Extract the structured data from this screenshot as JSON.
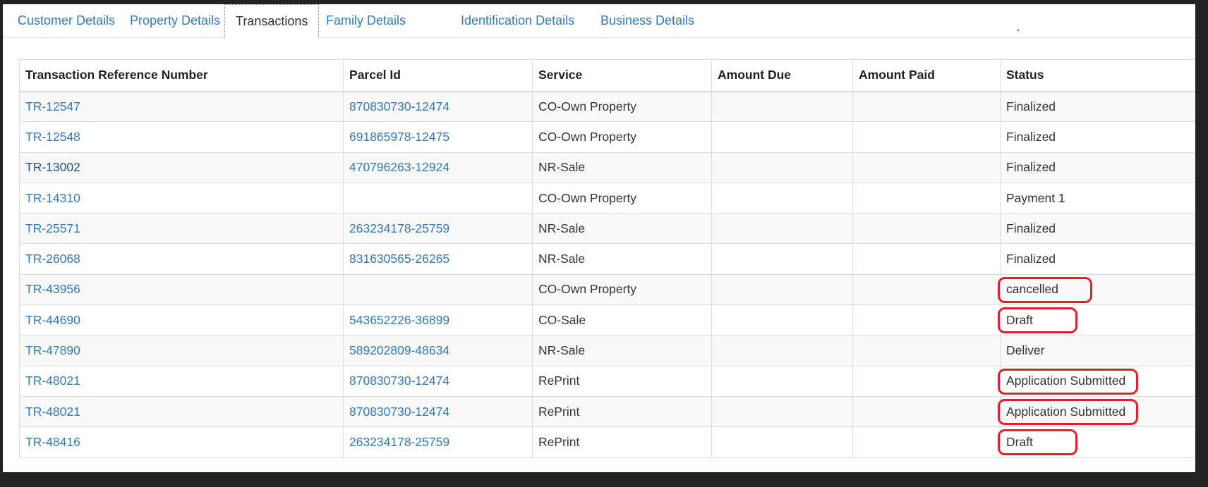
{
  "tabs": [
    {
      "label": "Customer Details",
      "active": false
    },
    {
      "label": "Property Details",
      "active": false
    },
    {
      "label": "Transactions",
      "active": true
    },
    {
      "label": "Family Details",
      "active": false
    },
    {
      "label": "Identification Details",
      "active": false
    },
    {
      "label": "Business Details",
      "active": false
    }
  ],
  "table": {
    "headers": [
      "Transaction Reference Number",
      "Parcel Id",
      "Service",
      "Amount Due",
      "Amount Paid",
      "Status"
    ],
    "rows": [
      {
        "ref": "TR-12547",
        "parcel": "870830730-12474",
        "service": "CO-Own Property",
        "amount_due": "",
        "amount_paid": "",
        "status": "Finalized",
        "highlighted": false
      },
      {
        "ref": "TR-12548",
        "parcel": "691865978-12475",
        "service": "CO-Own Property",
        "amount_due": "",
        "amount_paid": "",
        "status": "Finalized",
        "highlighted": false
      },
      {
        "ref": "TR-13002",
        "parcel": "470796263-12924",
        "service": "NR-Sale",
        "amount_due": "",
        "amount_paid": "",
        "status": "Finalized",
        "highlighted": false
      },
      {
        "ref": "TR-14310",
        "parcel": "",
        "service": "CO-Own Property",
        "amount_due": "",
        "amount_paid": "",
        "status": "Payment 1",
        "highlighted": false
      },
      {
        "ref": "TR-25571",
        "parcel": "263234178-25759",
        "service": "NR-Sale",
        "amount_due": "",
        "amount_paid": "",
        "status": "Finalized",
        "highlighted": false
      },
      {
        "ref": "TR-26068",
        "parcel": "831630565-26265",
        "service": "NR-Sale",
        "amount_due": "",
        "amount_paid": "",
        "status": "Finalized",
        "highlighted": false
      },
      {
        "ref": "TR-43956",
        "parcel": "",
        "service": "CO-Own Property",
        "amount_due": "",
        "amount_paid": "",
        "status": "cancelled",
        "highlighted": true
      },
      {
        "ref": "TR-44690",
        "parcel": "543652226-36899",
        "service": "CO-Sale",
        "amount_due": "",
        "amount_paid": "",
        "status": "Draft",
        "highlighted": true
      },
      {
        "ref": "TR-47890",
        "parcel": "589202809-48634",
        "service": "NR-Sale",
        "amount_due": "",
        "amount_paid": "",
        "status": "Deliver",
        "highlighted": false
      },
      {
        "ref": "TR-48021",
        "parcel": "870830730-12474",
        "service": "RePrint",
        "amount_due": "",
        "amount_paid": "",
        "status": "Application Submitted",
        "highlighted": true
      },
      {
        "ref": "TR-48021",
        "parcel": "870830730-12474",
        "service": "RePrint",
        "amount_due": "",
        "amount_paid": "",
        "status": "Application Submitted",
        "highlighted": true
      },
      {
        "ref": "TR-48416",
        "parcel": "263234178-25759",
        "service": "RePrint",
        "amount_due": "",
        "amount_paid": "",
        "status": "Draft",
        "highlighted": true
      }
    ]
  },
  "colors": {
    "link": "#337ab7",
    "link_visited": "#23527c",
    "highlight_mark": "#e2202a",
    "row_stripe": "#f9f9f9",
    "outer_background": "#222222"
  }
}
